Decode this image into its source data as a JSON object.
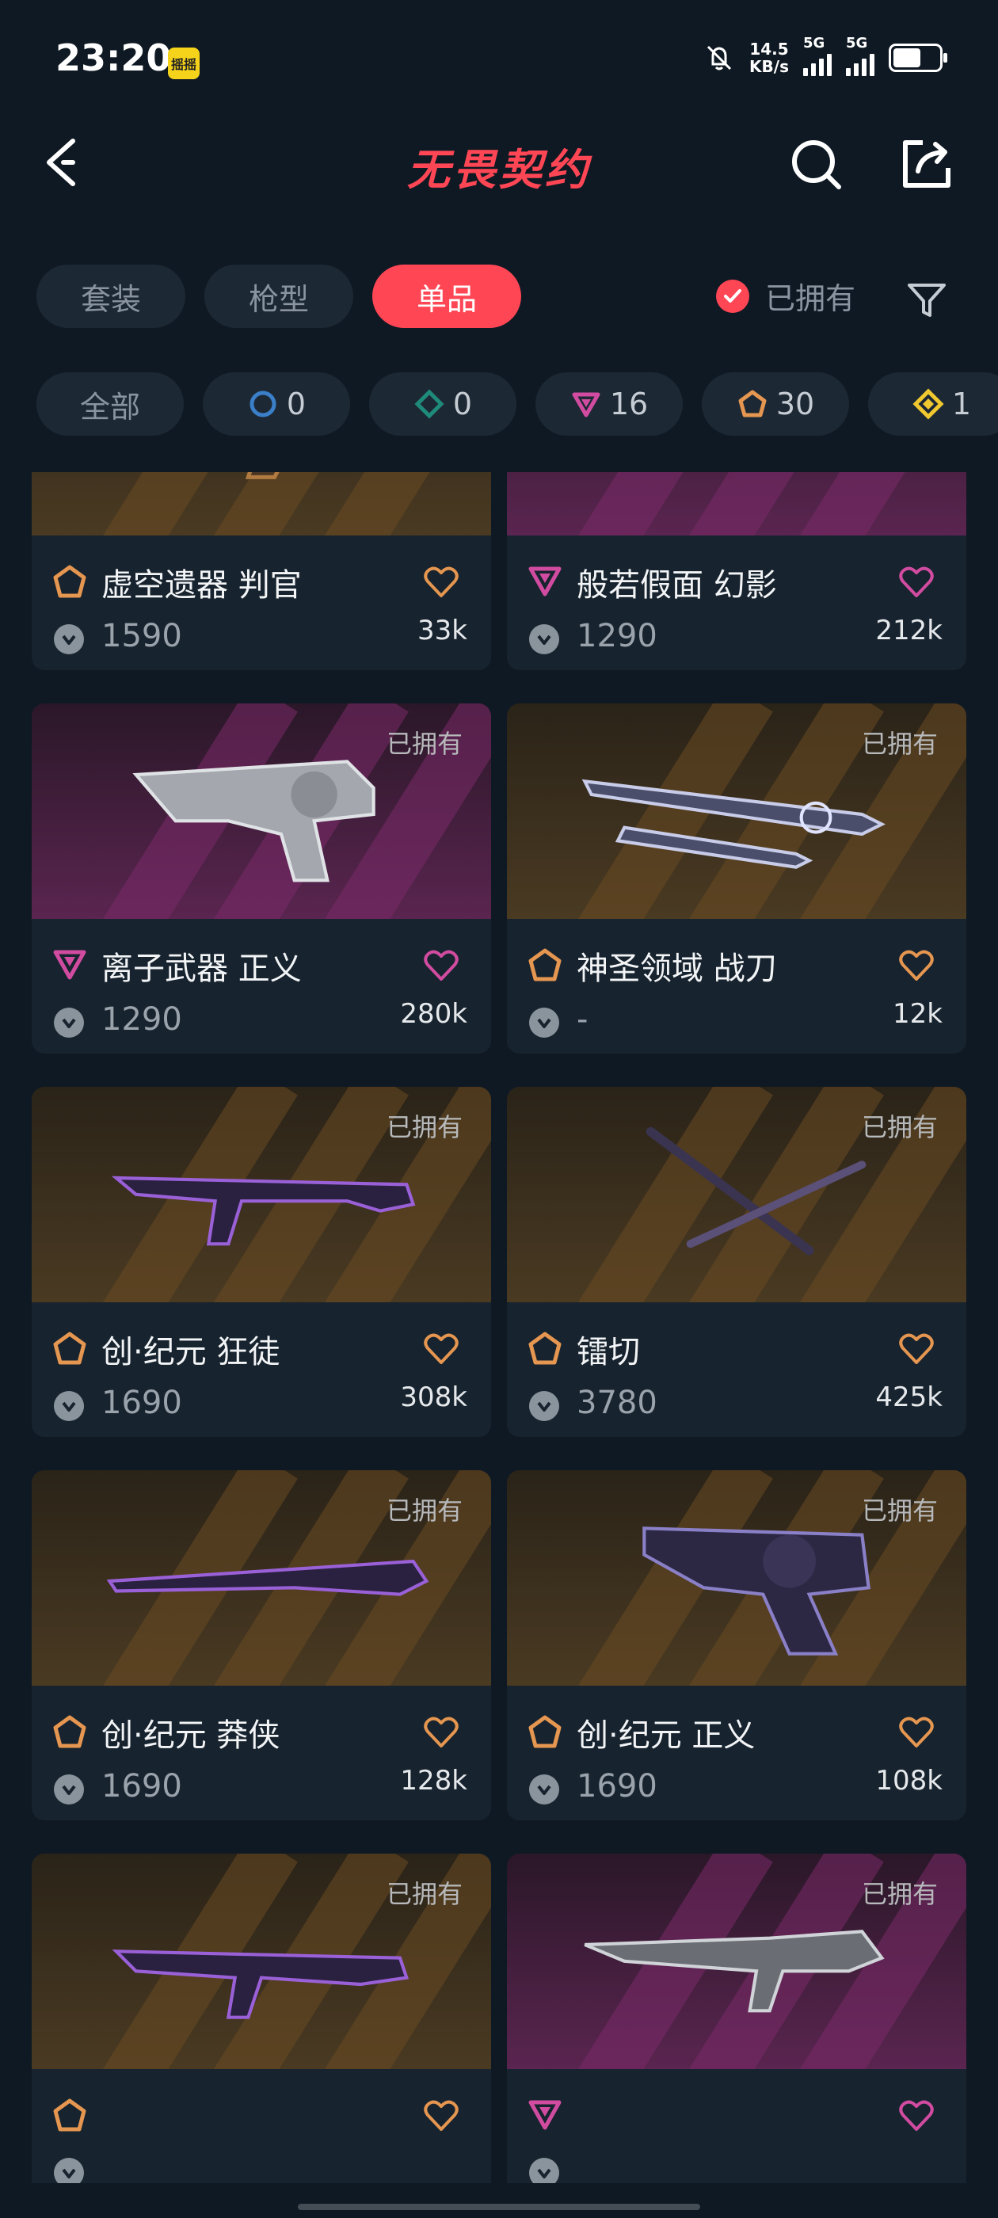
{
  "status_bar": {
    "time": "23:20",
    "app_badge": "摇摇",
    "net_speed_value": "14.5",
    "net_speed_unit": "KB/s",
    "sim1_label": "5G",
    "sim2_label": "5G"
  },
  "header": {
    "title": "无畏契约"
  },
  "tabs": [
    {
      "label": "套装"
    },
    {
      "label": "枪型"
    },
    {
      "label": "单品"
    }
  ],
  "owned_filter": {
    "label": "已拥有"
  },
  "rarity_chips": [
    {
      "label": "全部"
    },
    {
      "count": "0",
      "icon": "select-tier-icon",
      "color": "#3a7fc8"
    },
    {
      "count": "0",
      "icon": "deluxe-tier-icon",
      "color": "#1f8a7a"
    },
    {
      "count": "16",
      "icon": "premium-tier-icon",
      "color": "#d14ca0"
    },
    {
      "count": "30",
      "icon": "exclusive-tier-icon",
      "color": "#e59650"
    },
    {
      "count": "1",
      "icon": "ultra-tier-icon",
      "color": "#f0c830"
    }
  ],
  "cards": [
    {
      "name": "虚空遗器 判官",
      "price": "1590",
      "likes": "33k",
      "tier": "exclusive",
      "bg": "gold",
      "owned": ""
    },
    {
      "name": "般若假面 幻影",
      "price": "1290",
      "likes": "212k",
      "tier": "premium",
      "bg": "purple",
      "owned": ""
    },
    {
      "name": "离子武器 正义",
      "price": "1290",
      "likes": "280k",
      "tier": "premium",
      "bg": "purple",
      "owned": "已拥有"
    },
    {
      "name": "神圣领域 战刀",
      "price": "-",
      "likes": "12k",
      "tier": "exclusive",
      "bg": "gold",
      "owned": "已拥有"
    },
    {
      "name": "创·纪元 狂徒",
      "price": "1690",
      "likes": "308k",
      "tier": "exclusive",
      "bg": "gold",
      "owned": "已拥有"
    },
    {
      "name": "镭切",
      "price": "3780",
      "likes": "425k",
      "tier": "exclusive",
      "bg": "gold",
      "owned": "已拥有"
    },
    {
      "name": "创·纪元 莽侠",
      "price": "1690",
      "likes": "128k",
      "tier": "exclusive",
      "bg": "gold",
      "owned": "已拥有"
    },
    {
      "name": "创·纪元 正义",
      "price": "1690",
      "likes": "108k",
      "tier": "exclusive",
      "bg": "gold",
      "owned": "已拥有"
    },
    {
      "name": "",
      "price": "",
      "likes": "",
      "tier": "exclusive",
      "bg": "gold",
      "owned": "已拥有"
    },
    {
      "name": "",
      "price": "",
      "likes": "",
      "tier": "premium",
      "bg": "purple",
      "owned": "已拥有"
    }
  ],
  "colors": {
    "accent": "#ff4655",
    "background": "#0f1923",
    "card": "#17232e",
    "exclusive": "#e59650",
    "premium": "#d14ca0"
  }
}
